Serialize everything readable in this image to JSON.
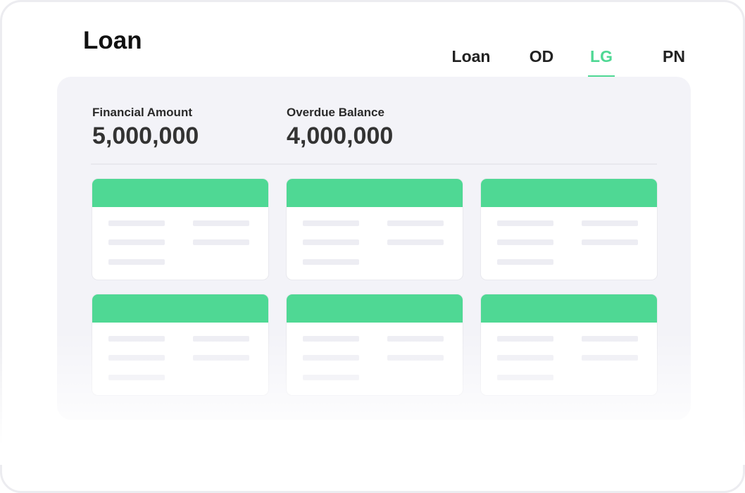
{
  "header": {
    "title": "Loan"
  },
  "tabs": [
    {
      "label": "Loan",
      "active": false
    },
    {
      "label": "OD",
      "active": false
    },
    {
      "label": "LG",
      "active": true
    },
    {
      "label": "PN",
      "active": false
    }
  ],
  "summary": {
    "financial_amount_label": "Financial Amount",
    "financial_amount_value": "5,000,000",
    "overdue_balance_label": "Overdue Balance",
    "overdue_balance_value": "4,000,000"
  },
  "colors": {
    "accent": "#4fd894",
    "panel_background": "#f3f3f8",
    "placeholder_line": "#ededf3"
  },
  "cards": [
    {
      "header_color": "#4fd894"
    },
    {
      "header_color": "#4fd894"
    },
    {
      "header_color": "#4fd894"
    },
    {
      "header_color": "#4fd894"
    },
    {
      "header_color": "#4fd894"
    },
    {
      "header_color": "#4fd894"
    }
  ]
}
